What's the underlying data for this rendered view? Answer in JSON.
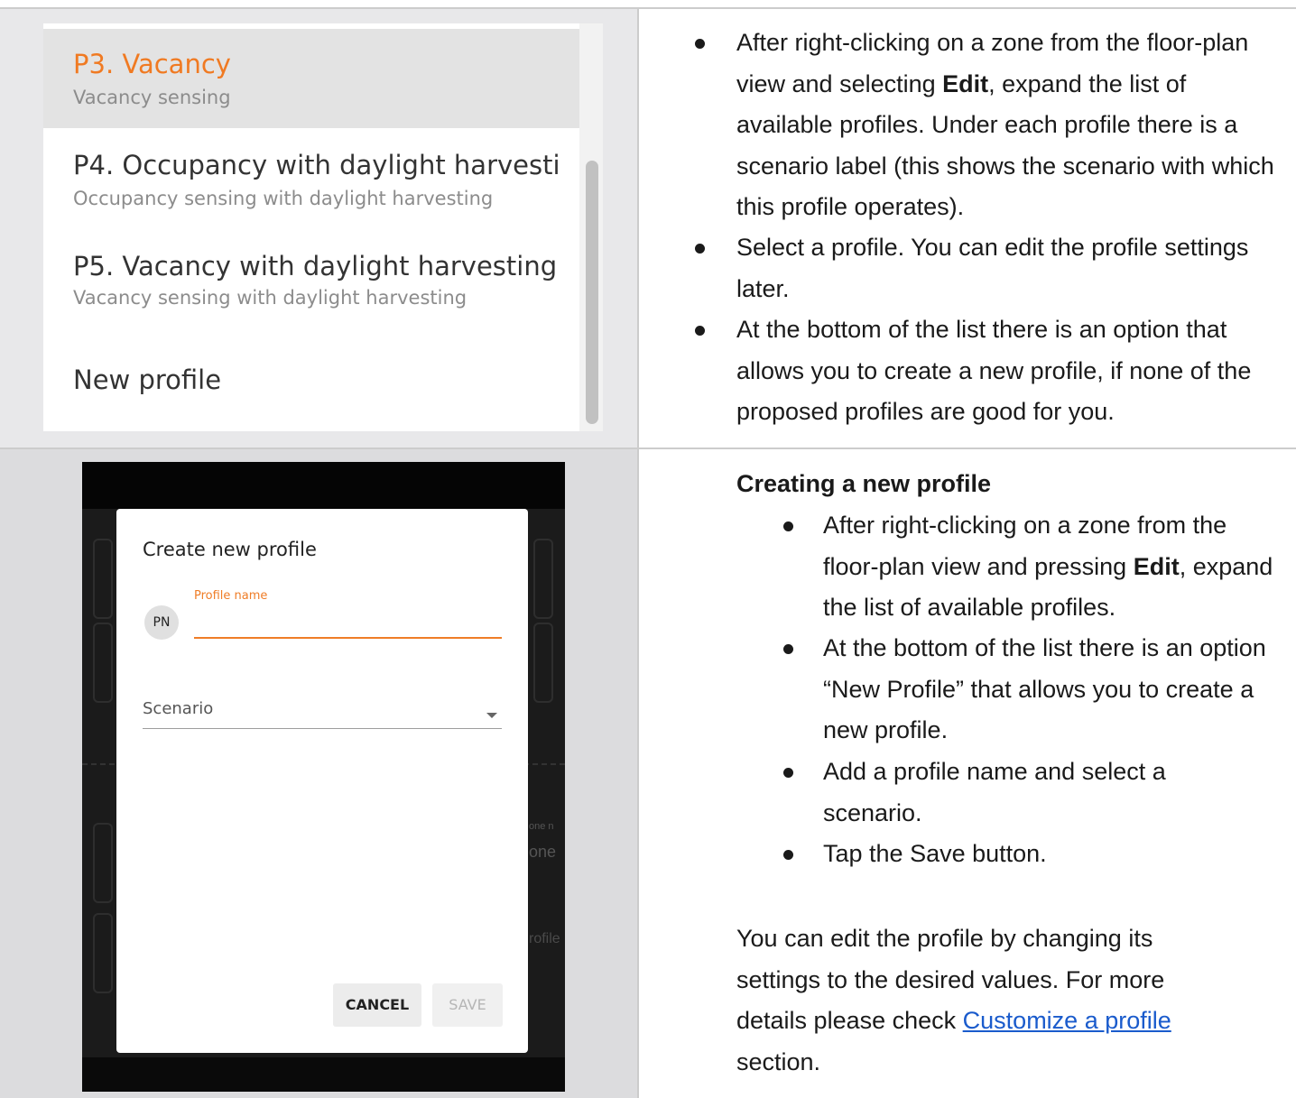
{
  "profile_list": {
    "items": [
      {
        "title": "P3. Vacancy",
        "subtitle": "Vacancy sensing",
        "selected": true
      },
      {
        "title": "P4. Occupancy with daylight harvesti",
        "subtitle": "Occupancy sensing with daylight harvesting",
        "selected": false
      },
      {
        "title": "P5. Vacancy with daylight harvesting",
        "subtitle": "Vacancy sensing with daylight harvesting",
        "selected": false
      }
    ],
    "new_profile": "New profile",
    "colors": {
      "selected_title": "#f07a22",
      "selected_bg": "#e3e3e3"
    }
  },
  "dialog": {
    "title": "Create new profile",
    "avatar": "PN",
    "profile_name_label": "Profile name",
    "profile_name_value": "",
    "scenario_label": "Scenario",
    "cancel_label": "CANCEL",
    "save_label": "SAVE",
    "accent_color": "#ef7d27",
    "background_fragments": [
      "one n",
      "one",
      "rofile"
    ]
  },
  "instructions": {
    "bullets": [
      {
        "pre": "After right-clicking on a zone from the floor-plan view and selecting ",
        "bold": "Edit",
        "post": ", expand the list of available profiles. Under each profile there is a scenario label (this shows the scenario with which this profile operates)."
      },
      {
        "pre": "Select a profile. You can edit the profile settings later.",
        "bold": "",
        "post": ""
      },
      {
        "pre": "At the bottom of the list there is an option that allows you to create a new profile, if none of the proposed profiles are good for you.",
        "bold": "",
        "post": ""
      }
    ]
  },
  "creating": {
    "heading": "Creating a new profile",
    "bullets": [
      {
        "pre": "After right-clicking on a zone from the floor-plan view and pressing ",
        "bold": "Edit",
        "post": ", expand the list of available profiles."
      },
      {
        "pre": "At the bottom of the list there is an option “New Profile” that allows you to create a new profile.",
        "bold": "",
        "post": ""
      },
      {
        "pre": "Add a profile name and select a scenario.",
        "bold": "",
        "post": ""
      },
      {
        "pre": "Tap the Save button.",
        "bold": "",
        "post": ""
      }
    ],
    "outro_pre": "You can edit the profile by changing its settings to the desired values. For more details please check ",
    "outro_link": "Customize a profile",
    "outro_post": " section.",
    "link_color": "#1a5bcc"
  }
}
